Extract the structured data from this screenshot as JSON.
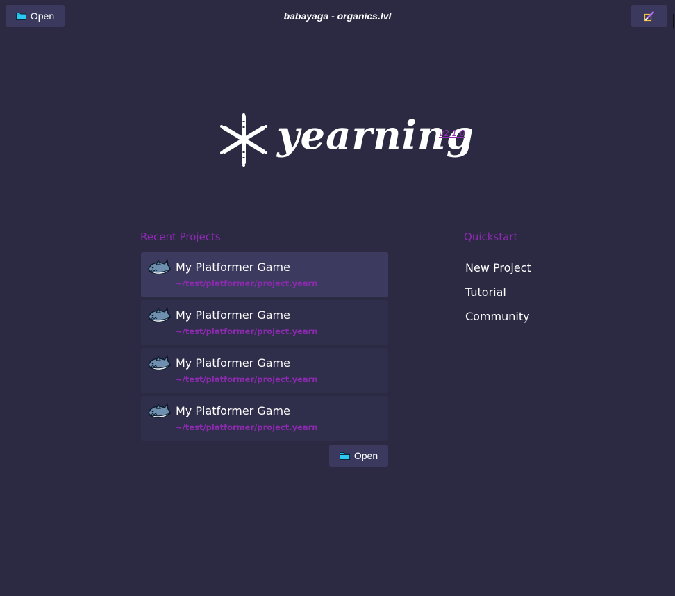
{
  "topbar": {
    "open_label": "Open",
    "window_title": "babayaga - organics.lvl",
    "tool_icon": "brush-icon"
  },
  "logo": {
    "wordmark": "yearning",
    "version": "v2.1.0"
  },
  "recent": {
    "heading": "Recent Projects",
    "items": [
      {
        "name": "My Platformer Game",
        "path": "~/test/platformer/project.yearn",
        "icon": "shark-icon"
      },
      {
        "name": "My Platformer Game",
        "path": "~/test/platformer/project.yearn",
        "icon": "shark-icon"
      },
      {
        "name": "My Platformer Game",
        "path": "~/test/platformer/project.yearn",
        "icon": "shark-icon"
      },
      {
        "name": "My Platformer Game",
        "path": "~/test/platformer/project.yearn",
        "icon": "shark-icon"
      }
    ],
    "open_label": "Open"
  },
  "quickstart": {
    "heading": "Quickstart",
    "items": [
      {
        "label": "New Project"
      },
      {
        "label": "Tutorial"
      },
      {
        "label": "Community"
      }
    ]
  },
  "colors": {
    "background": "#2b2a42",
    "button": "#3b3a5e",
    "card": "#2f2e4b",
    "card_active": "#3c3b5f",
    "accent_purple": "#8c2bb1",
    "folder_blue": "#1fb6e8"
  }
}
